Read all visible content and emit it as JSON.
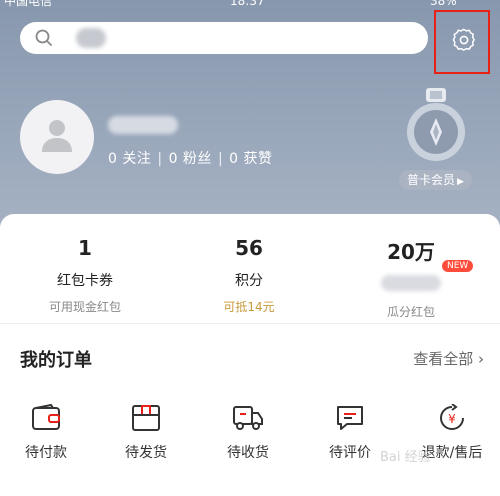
{
  "status_bar": {
    "carrier": "中国电信",
    "time": "18:37",
    "battery": "38%"
  },
  "search": {
    "placeholder": ""
  },
  "profile": {
    "follow": "0 关注",
    "fans": "0 粉丝",
    "likes": "0 获赞",
    "separator": "|",
    "member_label": "普卡会员",
    "member_arrow": "▶"
  },
  "assets": [
    {
      "value": "1",
      "label": "红包卡券",
      "sub": "可用现金红包"
    },
    {
      "value": "56",
      "label": "积分",
      "sub": "可抵14元"
    },
    {
      "value": "20万",
      "label": "",
      "sub": "瓜分红包",
      "tag": "NEW"
    }
  ],
  "orders": {
    "title": "我的订单",
    "view_all": "查看全部",
    "view_all_arrow": "›",
    "items": [
      {
        "label": "待付款",
        "icon": "wallet-icon"
      },
      {
        "label": "待发货",
        "icon": "package-icon"
      },
      {
        "label": "待收货",
        "icon": "truck-icon"
      },
      {
        "label": "待评价",
        "icon": "comment-icon"
      },
      {
        "label": "退款/售后",
        "icon": "refund-icon"
      }
    ]
  },
  "watermark": "Bai 经验",
  "colors": {
    "header": "#98a6ba",
    "accent": "#e62117",
    "gold": "#c79a3a",
    "tag": "#ff4c3b"
  }
}
